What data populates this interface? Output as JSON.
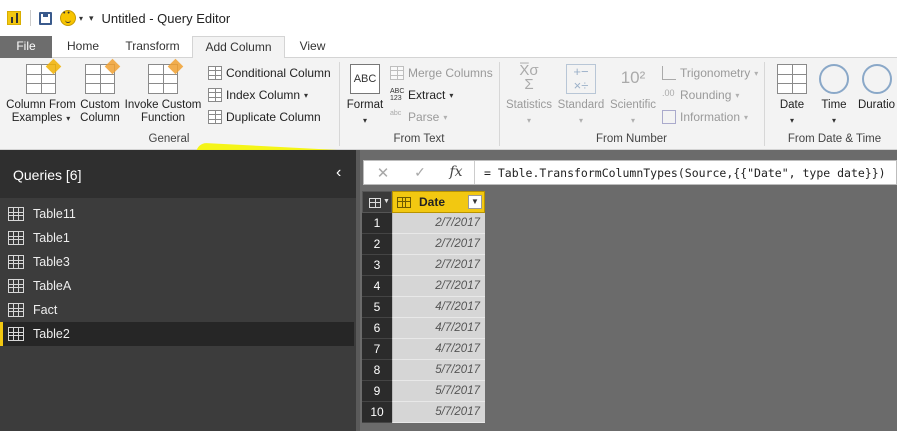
{
  "window": {
    "title": "Untitled - Query Editor",
    "icons": [
      "power-bi-logo",
      "save-icon",
      "smiley-feedback-icon"
    ]
  },
  "ribbon_tabs": [
    {
      "label": "File",
      "active": false
    },
    {
      "label": "Home",
      "active": false
    },
    {
      "label": "Transform",
      "active": false
    },
    {
      "label": "Add Column",
      "active": true
    },
    {
      "label": "View",
      "active": false
    }
  ],
  "ribbon": {
    "general": {
      "label": "General",
      "column_from_examples": [
        "Column From",
        "Examples"
      ],
      "custom_column": [
        "Custom",
        "Column"
      ],
      "invoke_custom_function": [
        "Invoke Custom",
        "Function"
      ],
      "conditional_column": "Conditional Column",
      "index_column": "Index Column",
      "duplicate_column": "Duplicate Column"
    },
    "from_text": {
      "label": "From Text",
      "format": "Format",
      "merge_columns": "Merge Columns",
      "extract": "Extract",
      "parse": "Parse"
    },
    "from_number": {
      "label": "From Number",
      "statistics": "Statistics",
      "standard": "Standard",
      "scientific": "Scientific",
      "trigonometry": "Trigonometry",
      "rounding": "Rounding",
      "information": "Information"
    },
    "from_date_time": {
      "label": "From Date & Time",
      "date": "Date",
      "time": "Time",
      "duration": "Duratio"
    },
    "highlight_color": "#f5f500"
  },
  "queries": {
    "title": "Queries [6]",
    "items": [
      "Table11",
      "Table1",
      "Table3",
      "TableA",
      "Fact",
      "Table2"
    ],
    "selected": "Table2"
  },
  "formula_bar": {
    "formula": "= Table.TransformColumnTypes(Source,{{\"Date\", type date}})"
  },
  "grid": {
    "column_header": "Date",
    "rows": [
      {
        "n": "1",
        "date": "2/7/2017"
      },
      {
        "n": "2",
        "date": "2/7/2017"
      },
      {
        "n": "3",
        "date": "2/7/2017"
      },
      {
        "n": "4",
        "date": "2/7/2017"
      },
      {
        "n": "5",
        "date": "4/7/2017"
      },
      {
        "n": "6",
        "date": "4/7/2017"
      },
      {
        "n": "7",
        "date": "4/7/2017"
      },
      {
        "n": "8",
        "date": "5/7/2017"
      },
      {
        "n": "9",
        "date": "5/7/2017"
      },
      {
        "n": "10",
        "date": "5/7/2017"
      }
    ]
  },
  "colors": {
    "accent": "#f2c811",
    "left_pane": "#3c3c3c",
    "grid_background": "#6b6b6b"
  }
}
